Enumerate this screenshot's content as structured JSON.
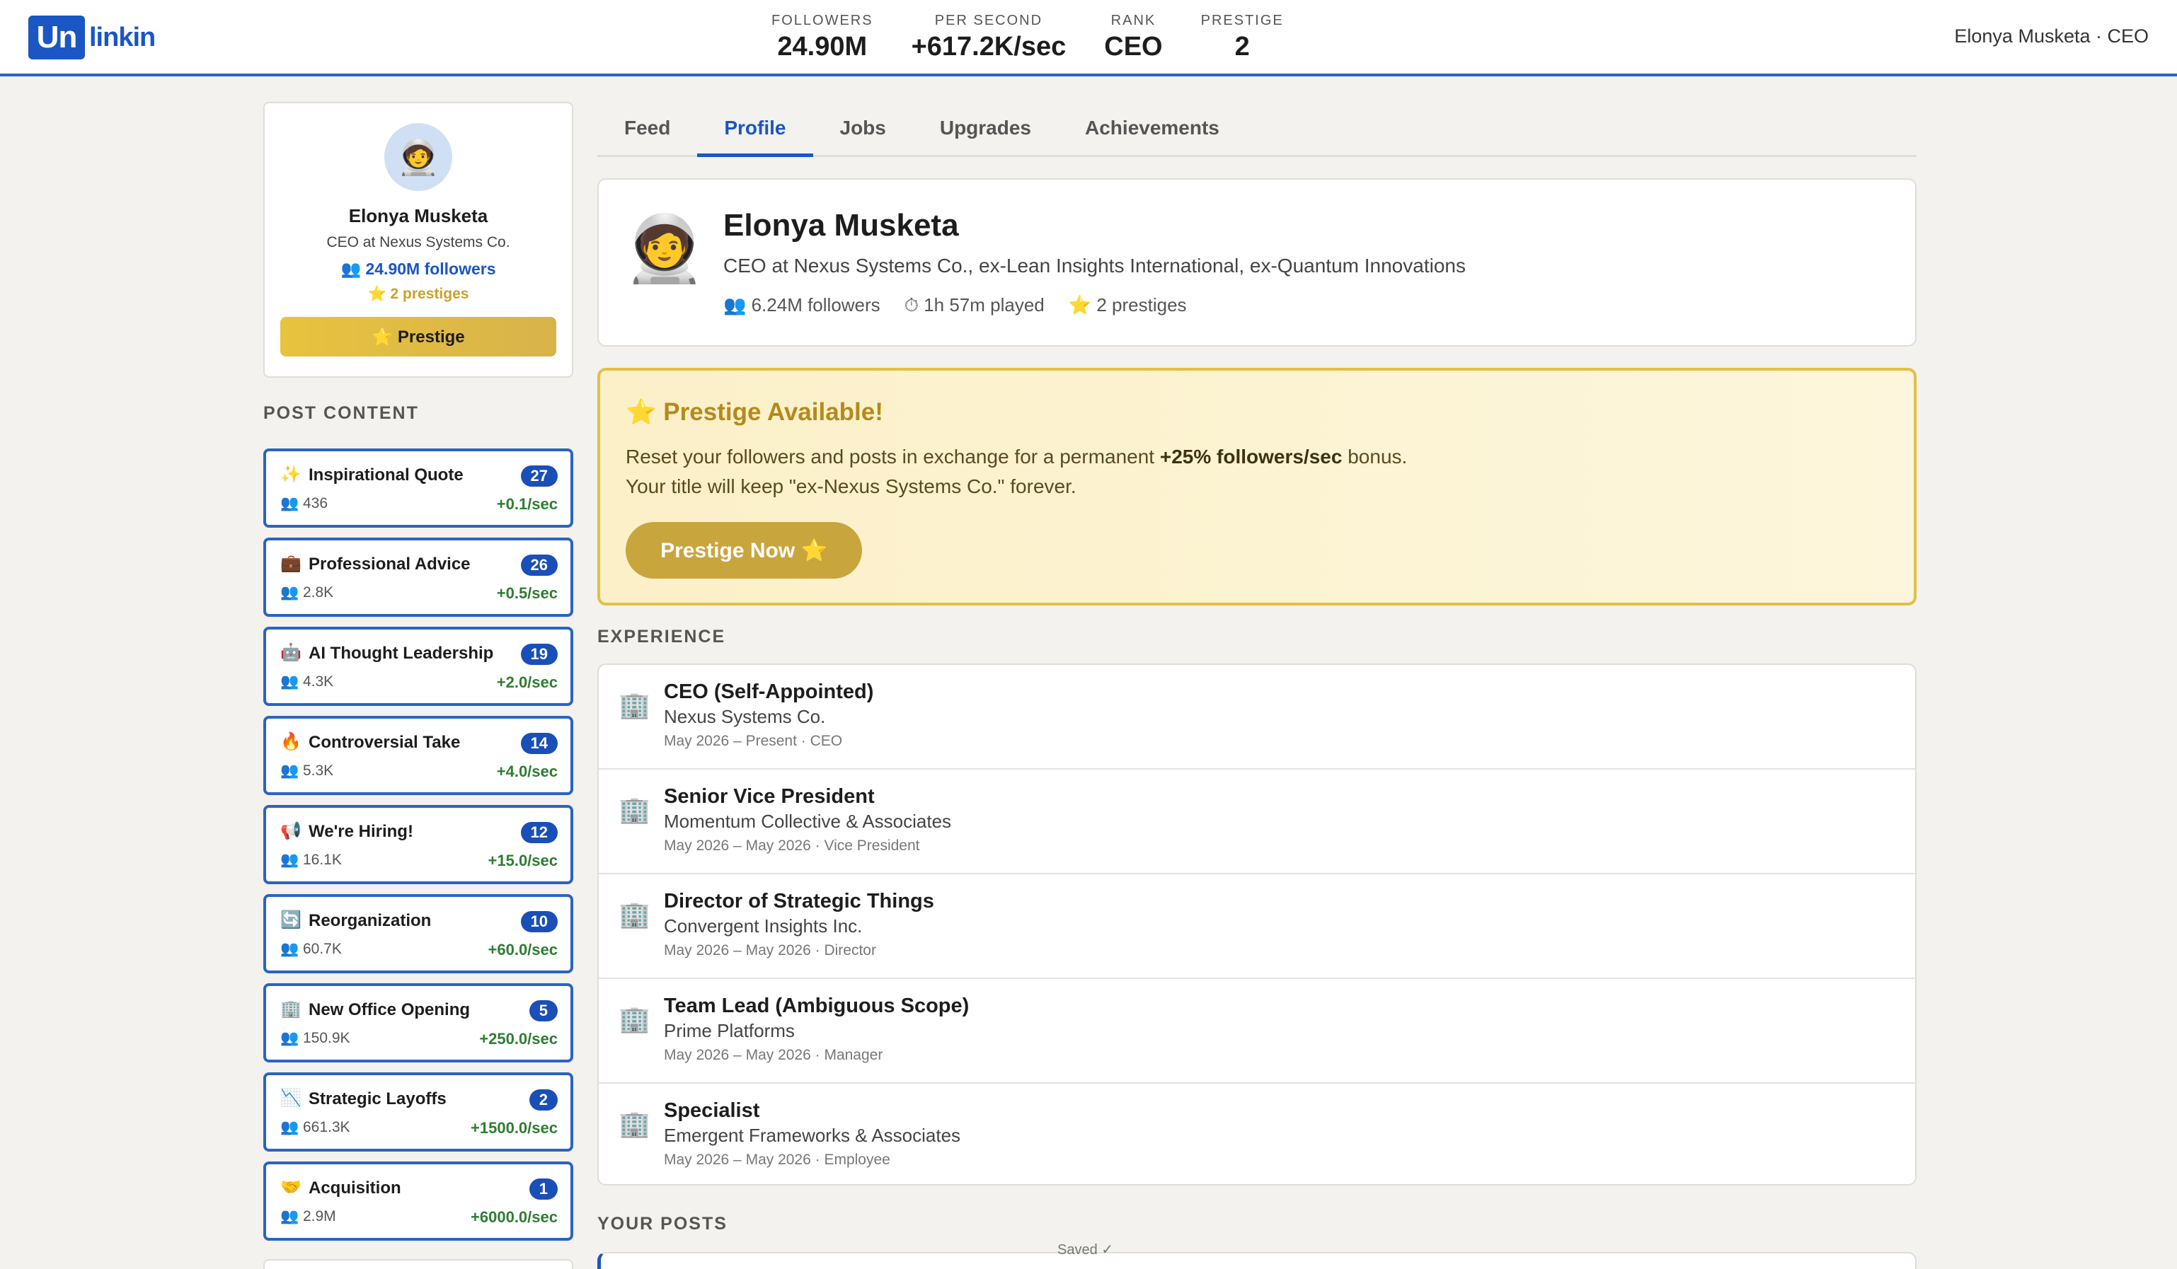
{
  "brand": {
    "logo_mark": "Un",
    "logo_text": "linkin"
  },
  "stats": [
    {
      "label": "FOLLOWERS",
      "value": "24.90M"
    },
    {
      "label": "PER SECOND",
      "value": "+617.2K/sec"
    },
    {
      "label": "RANK",
      "value": "CEO"
    },
    {
      "label": "PRESTIGE",
      "value": "2"
    }
  ],
  "user_top": "Elonya Musketa · CEO",
  "sidebar": {
    "avatar_emoji": "🧑‍🚀",
    "name": "Elonya Musketa",
    "title": "CEO at Nexus Systems Co.",
    "followers": "👥 24.90M followers",
    "prestiges": "⭐ 2 prestiges",
    "prestige_button": "⭐ Prestige",
    "section_label": "POST CONTENT",
    "posts": [
      {
        "icon": "✨",
        "icon_name": "sparkles-icon",
        "name": "Inspirational Quote",
        "badge": "27",
        "count": "👥 436",
        "rate": "+0.1/sec"
      },
      {
        "icon": "💼",
        "icon_name": "briefcase-icon",
        "name": "Professional Advice",
        "badge": "26",
        "count": "👥 2.8K",
        "rate": "+0.5/sec"
      },
      {
        "icon": "🤖",
        "icon_name": "robot-icon",
        "name": "AI Thought Leadership",
        "badge": "19",
        "count": "👥 4.3K",
        "rate": "+2.0/sec"
      },
      {
        "icon": "🔥",
        "icon_name": "fire-icon",
        "name": "Controversial Take",
        "badge": "14",
        "count": "👥 5.3K",
        "rate": "+4.0/sec"
      },
      {
        "icon": "📢",
        "icon_name": "megaphone-icon",
        "name": "We're Hiring!",
        "badge": "12",
        "count": "👥 16.1K",
        "rate": "+15.0/sec"
      },
      {
        "icon": "🔄",
        "icon_name": "cycle-icon",
        "name": "Reorganization",
        "badge": "10",
        "count": "👥 60.7K",
        "rate": "+60.0/sec"
      },
      {
        "icon": "🏢",
        "icon_name": "office-building-icon",
        "name": "New Office Opening",
        "badge": "5",
        "count": "👥 150.9K",
        "rate": "+250.0/sec"
      },
      {
        "icon": "📉",
        "icon_name": "chart-down-icon",
        "name": "Strategic Layoffs",
        "badge": "2",
        "count": "👥 661.3K",
        "rate": "+1500.0/sec"
      },
      {
        "icon": "🤝",
        "icon_name": "handshake-icon",
        "name": "Acquisition",
        "badge": "1",
        "count": "👥 2.9M",
        "rate": "+6000.0/sec"
      }
    ]
  },
  "tabs": [
    {
      "label": "Feed",
      "active": false
    },
    {
      "label": "Profile",
      "active": true
    },
    {
      "label": "Jobs",
      "active": false
    },
    {
      "label": "Upgrades",
      "active": false
    },
    {
      "label": "Achievements",
      "active": false
    }
  ],
  "profile": {
    "avatar_emoji": "🧑‍🚀",
    "name": "Elonya Musketa",
    "title": "CEO at Nexus Systems Co., ex-Lean Insights International, ex-Quantum Innovations",
    "followers": "👥 6.24M followers",
    "played": "⏱ 1h 57m played",
    "prestiges": "⭐ 2 prestiges"
  },
  "banner": {
    "title": "⭐ Prestige Available!",
    "line1_pre": "Reset your followers and posts in exchange for a permanent ",
    "line1_bold": "+25% followers/sec",
    "line1_post": " bonus.",
    "line2": "Your title will keep \"ex-Nexus Systems Co.\" forever.",
    "button": "Prestige Now ⭐"
  },
  "experience": {
    "label": "EXPERIENCE",
    "icon": "🏢",
    "items": [
      {
        "title": "CEO (Self-Appointed)",
        "company": "Nexus Systems Co.",
        "dates": "May 2026 – Present · CEO"
      },
      {
        "title": "Senior Vice President",
        "company": "Momentum Collective & Associates",
        "dates": "May 2026 – May 2026 · Vice President"
      },
      {
        "title": "Director of Strategic Things",
        "company": "Convergent Insights Inc.",
        "dates": "May 2026 – May 2026 · Director"
      },
      {
        "title": "Team Lead (Ambiguous Scope)",
        "company": "Prime Platforms",
        "dates": "May 2026 – May 2026 · Manager"
      },
      {
        "title": "Specialist",
        "company": "Emergent Frameworks & Associates",
        "dates": "May 2026 – May 2026 · Employee"
      }
    ]
  },
  "your_posts_label": "YOUR POSTS",
  "saved_text": "Saved ✓"
}
